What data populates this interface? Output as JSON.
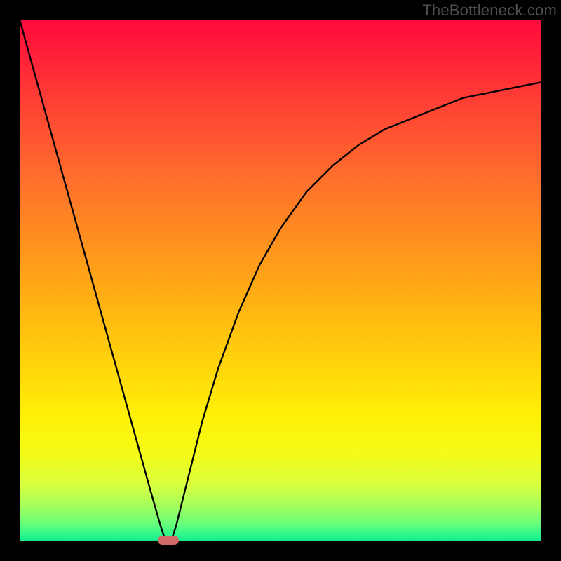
{
  "watermark": "TheBottleneck.com",
  "colors": {
    "curve": "#000000",
    "marker": "#cf6a68",
    "gradient_top": "#ff0a3b",
    "gradient_bottom": "#14e98d"
  },
  "chart_data": {
    "type": "line",
    "title": "",
    "xlabel": "",
    "ylabel": "",
    "xlim": [
      0,
      100
    ],
    "ylim": [
      0,
      100
    ],
    "grid": false,
    "series": [
      {
        "name": "bottleneck-curve",
        "x": [
          0,
          5,
          10,
          15,
          20,
          25,
          27,
          28,
          29,
          30,
          32,
          35,
          38,
          42,
          46,
          50,
          55,
          60,
          65,
          70,
          75,
          80,
          85,
          90,
          95,
          100
        ],
        "values": [
          100,
          82,
          64,
          46,
          28,
          10,
          3,
          0,
          0,
          3,
          11,
          23,
          33,
          44,
          53,
          60,
          67,
          72,
          76,
          79,
          81,
          83,
          85,
          86,
          87,
          88
        ]
      }
    ],
    "annotations": [
      {
        "name": "optimal-marker",
        "x": 28.5,
        "y": 0
      }
    ]
  }
}
